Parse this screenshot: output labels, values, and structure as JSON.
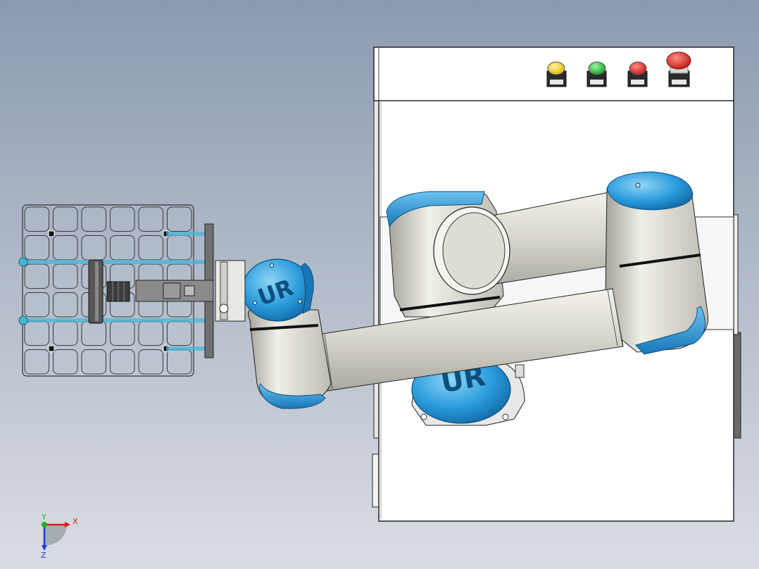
{
  "scene": {
    "colors": {
      "bg_top": "#8c9ab0",
      "bg_bottom": "#dadde3",
      "cabinet": "#ffffff",
      "outline": "#1a1a1a",
      "robot_blue": "#1e90d6",
      "robot_blue_light": "#6cc3f0",
      "arm_body": "#d9d8cf",
      "arm_shadow": "#9c9b94",
      "tray_line": "#333333",
      "tray_accent": "#46b6d8"
    },
    "buttons": [
      {
        "name": "yellow-button",
        "color": "#f2d21b"
      },
      {
        "name": "green-button",
        "color": "#29c23a"
      },
      {
        "name": "red-button",
        "color": "#e0251e"
      },
      {
        "name": "emergency-stop",
        "color": "#e0251e"
      }
    ],
    "robot_logo": "UR"
  },
  "axis_triad": {
    "x_label": "X",
    "y_label": "Y",
    "z_label": "Z",
    "x_color": "#e01a1a",
    "y_color": "#1ab31a",
    "z_color": "#1a3ae0"
  }
}
